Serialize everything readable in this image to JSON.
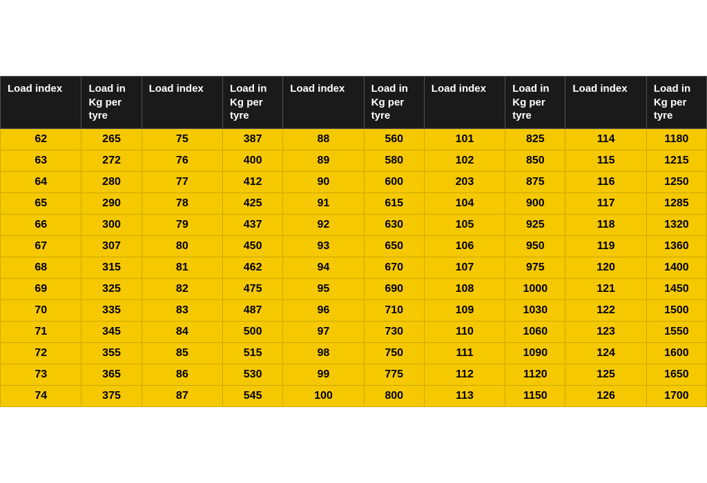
{
  "headers": [
    "Load index",
    "Load in Kg per tyre",
    "Load index",
    "Load in Kg per tyre",
    "Load index",
    "Load in Kg per tyre",
    "Load index",
    "Load in Kg per tyre",
    "Load index",
    "Load in Kg per tyre"
  ],
  "rows": [
    [
      62,
      265,
      75,
      387,
      88,
      560,
      101,
      825,
      114,
      1180
    ],
    [
      63,
      272,
      76,
      400,
      89,
      580,
      102,
      850,
      115,
      1215
    ],
    [
      64,
      280,
      77,
      412,
      90,
      600,
      203,
      875,
      116,
      1250
    ],
    [
      65,
      290,
      78,
      425,
      91,
      615,
      104,
      900,
      117,
      1285
    ],
    [
      66,
      300,
      79,
      437,
      92,
      630,
      105,
      925,
      118,
      1320
    ],
    [
      67,
      307,
      80,
      450,
      93,
      650,
      106,
      950,
      119,
      1360
    ],
    [
      68,
      315,
      81,
      462,
      94,
      670,
      107,
      975,
      120,
      1400
    ],
    [
      69,
      325,
      82,
      475,
      95,
      690,
      108,
      1000,
      121,
      1450
    ],
    [
      70,
      335,
      83,
      487,
      96,
      710,
      109,
      1030,
      122,
      1500
    ],
    [
      71,
      345,
      84,
      500,
      97,
      730,
      110,
      1060,
      123,
      1550
    ],
    [
      72,
      355,
      85,
      515,
      98,
      750,
      111,
      1090,
      124,
      1600
    ],
    [
      73,
      365,
      86,
      530,
      99,
      775,
      112,
      1120,
      125,
      1650
    ],
    [
      74,
      375,
      87,
      545,
      100,
      800,
      113,
      1150,
      126,
      1700
    ]
  ]
}
